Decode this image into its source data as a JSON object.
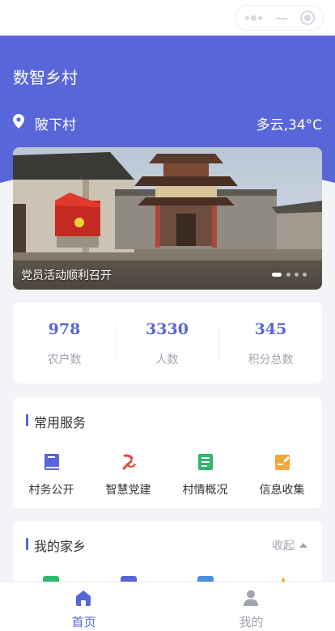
{
  "app": {
    "title": "数智乡村"
  },
  "location": {
    "village": "陂下村",
    "weather": "多云,34°C",
    "icon": "location-pin-icon"
  },
  "banner": {
    "caption": "党员活动顺利召开",
    "page_count": 4,
    "active_page": 1
  },
  "stats": [
    {
      "value": "978",
      "label": "农户数"
    },
    {
      "value": "3330",
      "label": "人数"
    },
    {
      "value": "345",
      "label": "积分总数"
    }
  ],
  "services": {
    "title": "常用服务",
    "items": [
      {
        "label": "村务公开",
        "icon": "book-icon",
        "color": "#5866d9"
      },
      {
        "label": "智慧党建",
        "icon": "party-emblem-icon",
        "color": "#e2463c"
      },
      {
        "label": "村情概况",
        "icon": "document-list-icon",
        "color": "#2eb86d"
      },
      {
        "label": "信息收集",
        "icon": "edit-note-icon",
        "color": "#f2a93b"
      }
    ]
  },
  "hometown": {
    "title": "我的家乡",
    "toggle_label": "收起",
    "icon_colors": [
      "#2eb86d",
      "#5866d9",
      "#4a8fe0",
      "#f2a93b"
    ]
  },
  "tabbar": {
    "items": [
      {
        "label": "首页",
        "icon": "home-icon",
        "active": true,
        "color": "#5866d9"
      },
      {
        "label": "我的",
        "icon": "user-icon",
        "active": false,
        "color": "#a0a4b0"
      }
    ]
  },
  "colors": {
    "primary": "#5866d9",
    "background": "#f3f4f8",
    "muted": "#a0a4b0"
  }
}
